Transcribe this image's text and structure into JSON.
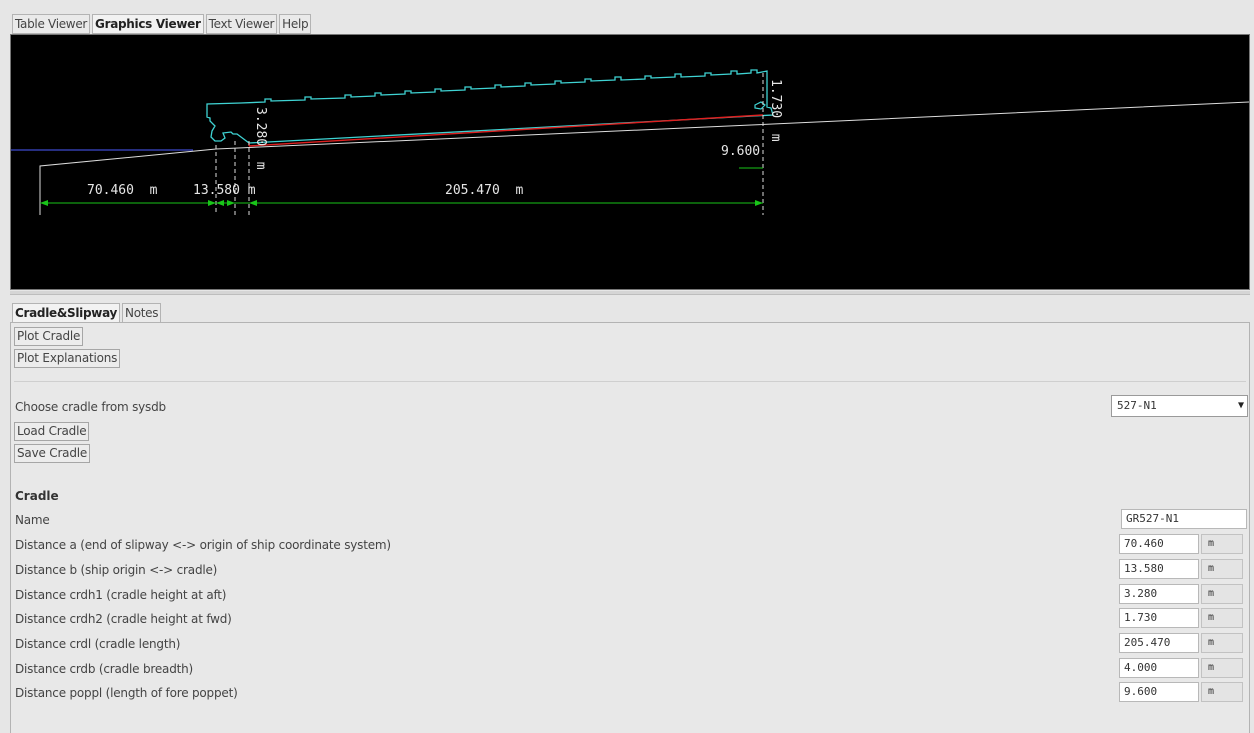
{
  "top_tabs": [
    "Table Viewer",
    "Graphics Viewer",
    "Text Viewer",
    "Help"
  ],
  "active_top_tab": "Graphics Viewer",
  "drawing": {
    "dim_a": "70.460  m",
    "dim_b": "13.580 m",
    "dim_crdl": "205.470  m",
    "dim_crdh1": "3.280  m",
    "dim_crdh2": "1.730  m",
    "dim_poppl": "9.600"
  },
  "bottom_tabs": [
    "Cradle&Slipway",
    "Notes"
  ],
  "active_bottom_tab": "Cradle&Slipway",
  "buttons": {
    "plot_cradle": "Plot Cradle",
    "plot_explanations": "Plot Explanations",
    "load_cradle": "Load Cradle",
    "save_cradle": "Save Cradle"
  },
  "choose_label": "Choose cradle from sysdb",
  "choose_value": "527-N1",
  "section_title": "Cradle",
  "name_label": "Name",
  "name_value": "GR527-N1",
  "rows": [
    {
      "label": "Distance a (end of slipway <-> origin of ship coordinate system)",
      "value": "70.460",
      "unit": "m"
    },
    {
      "label": "Distance b (ship origin <-> cradle)",
      "value": "13.580",
      "unit": "m"
    },
    {
      "label": "Distance crdh1 (cradle height at aft)",
      "value": "3.280",
      "unit": "m"
    },
    {
      "label": "Distance crdh2 (cradle height at fwd)",
      "value": "1.730",
      "unit": "m"
    },
    {
      "label": "Distance crdl (cradle length)",
      "value": "205.470",
      "unit": "m"
    },
    {
      "label": "Distance crdb (cradle breadth)",
      "value": "4.000",
      "unit": "m"
    },
    {
      "label": "Distance poppl (length of fore poppet)",
      "value": "9.600",
      "unit": "m"
    }
  ]
}
